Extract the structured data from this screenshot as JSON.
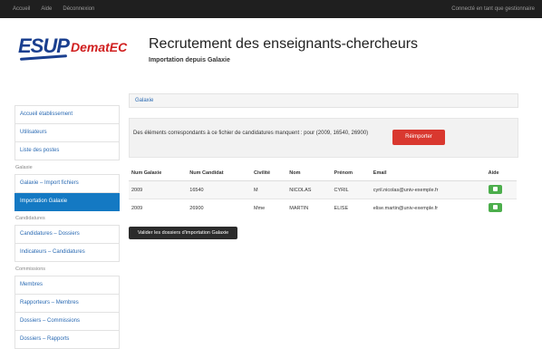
{
  "topbar": {
    "nav": [
      "Accueil",
      "Aide",
      "Déconnexion"
    ],
    "user": "Connecté en tant que gestionnaire"
  },
  "header": {
    "logo_esup": "ESUP",
    "logo_demat": "DematEC",
    "title": "Recrutement des enseignants-chercheurs",
    "subtitle": "Importation depuis Galaxie"
  },
  "sidebar": {
    "group0": [
      "Accueil établissement",
      "Utilisateurs",
      "Liste des postes"
    ],
    "group1_head": "Galaxie",
    "group1": [
      "Galaxie – Import fichiers",
      "Importation Galaxie"
    ],
    "group2_head": "Candidatures",
    "group2": [
      "Candidatures – Dossiers",
      "Indicateurs – Candidatures"
    ],
    "group3_head": "Commissions",
    "group3": [
      "Membres",
      "Rapporteurs – Membres",
      "Dossiers – Commissions",
      "Dossiers – Rapports"
    ]
  },
  "breadcrumb": "Galaxie",
  "alert": {
    "message": "Des éléments correspondants à ce fichier de candidatures manquent : pour (2009, 16540, 26900)",
    "button": "Réimporter"
  },
  "table": {
    "headers": [
      "Num Galaxie",
      "Num Candidat",
      "Civilité",
      "Nom",
      "Prénom",
      "Email",
      "Aide"
    ],
    "rows": [
      [
        "2009",
        "16540",
        "M",
        "NICOLAS",
        "CYRIL",
        "cyril.nicolas@univ-exemple.fr",
        ""
      ],
      [
        "2009",
        "26900",
        "Mme",
        "MARTIN",
        "ELISE",
        "elise.martin@univ-exemple.fr",
        ""
      ]
    ]
  },
  "action_button": "Valider les dossiers d'importation Galaxie",
  "colors": {
    "accent": "#1479c3",
    "danger": "#d9382f",
    "success": "#4cae4c"
  }
}
